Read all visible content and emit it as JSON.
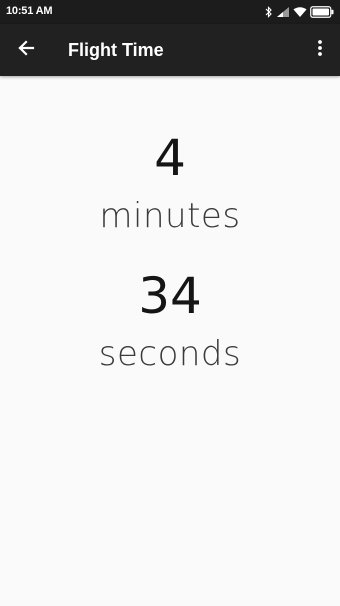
{
  "status_bar": {
    "time": "10:51 AM",
    "icons": [
      "bluetooth-icon",
      "signal-icon",
      "wifi-icon",
      "battery-icon"
    ]
  },
  "app_bar": {
    "title": "Flight Time",
    "back_icon": "arrow-back-icon",
    "menu_icon": "more-vert-icon"
  },
  "flight_time": {
    "minutes_value": "4",
    "minutes_unit": "minutes",
    "seconds_value": "34",
    "seconds_unit": "seconds"
  },
  "colors": {
    "app_bar": "#212121",
    "status_bar": "#1c1c1c",
    "background": "#fafafa",
    "text": "#151515"
  }
}
